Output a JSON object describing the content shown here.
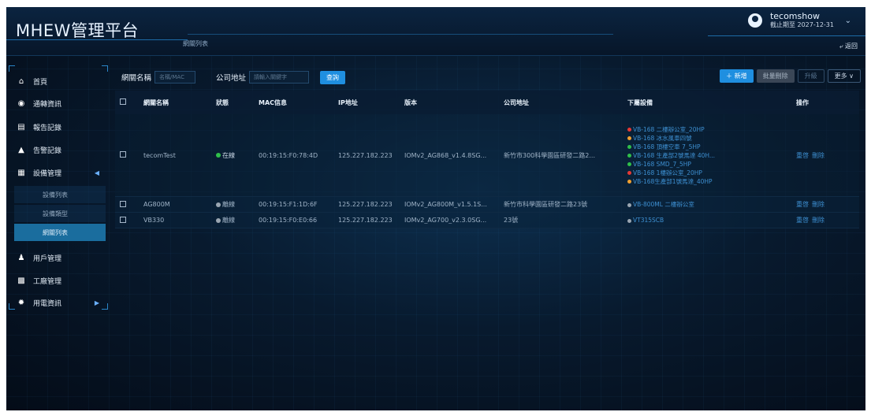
{
  "app": {
    "title": "MHEW管理平台"
  },
  "header": {
    "breadcrumb": "網關列表",
    "user_name": "tecomshow",
    "expire": "截止期至 2027-12-31",
    "back_label": "返回"
  },
  "sidebar": {
    "items": [
      {
        "label": "首頁",
        "icon": "home-icon"
      },
      {
        "label": "通轉資訊",
        "icon": "globe-icon"
      },
      {
        "label": "報告記錄",
        "icon": "report-icon"
      },
      {
        "label": "告警記錄",
        "icon": "bell-icon"
      },
      {
        "label": "設備管理",
        "icon": "grid-icon"
      },
      {
        "label": "用戶管理",
        "icon": "users-icon"
      },
      {
        "label": "工廠管理",
        "icon": "factory-icon"
      },
      {
        "label": "用電資訊",
        "icon": "gear-icon"
      }
    ],
    "sub_items": [
      {
        "label": "設備列表"
      },
      {
        "label": "設備類型"
      },
      {
        "label": "網關列表"
      }
    ]
  },
  "filters": {
    "name_label": "網關名稱",
    "name_placeholder": "名稱/MAC",
    "addr_label": "公司地址",
    "addr_placeholder": "請輸入關鍵字",
    "query_label": "查詢"
  },
  "toolbar": {
    "add_label": "＋ 新增",
    "batch_delete_label": "批量刪除",
    "upgrade_label": "升級",
    "more_label": "更多 ∨"
  },
  "table": {
    "headers": {
      "name": "網關名稱",
      "status": "狀態",
      "mac": "MAC信息",
      "ip": "IP地址",
      "version": "版本",
      "address": "公司地址",
      "devices": "下屬設備",
      "ops": "操作"
    },
    "rows": [
      {
        "name": "tecomTest",
        "status": "在線",
        "mac": "00:19:15:F0:78:4D",
        "ip": "125.227.182.223",
        "version": "IOMv2_AG868_v1.4.8SG...",
        "address": "新竹市300科學園區研發二路2...",
        "devices": [
          {
            "text": "VB-168 二樓辦公室_20HP",
            "color": "#e53935"
          },
          {
            "text": "VB-168 冰水風車四號",
            "color": "#f0a030"
          },
          {
            "text": "VB-168 頂樓空車 7_5HP",
            "color": "#2fbf4a"
          },
          {
            "text": "VB-168 生產部2號馬達 40H...",
            "color": "#2fbf4a"
          },
          {
            "text": "VB-168 SMD_7_5HP",
            "color": "#2fbf4a"
          },
          {
            "text": "VB-168 1樓辦公室_20HP",
            "color": "#e53935"
          },
          {
            "text": "VB-168生產部1號馬達_40HP",
            "color": "#f0a030"
          }
        ],
        "op_reset": "重啓",
        "op_delete": "刪除"
      },
      {
        "name": "AG800M",
        "status": "離線",
        "mac": "00:19:15:F1:1D:6F",
        "ip": "125.227.182.223",
        "version": "IOMv2_AG800M_v1.5.1S...",
        "address": "新竹市科學園區研發二路23號",
        "devices": [
          {
            "text": "VB-800ML 二樓辦公室",
            "color": "#9aa6b2"
          }
        ],
        "op_reset": "重啓",
        "op_delete": "刪除"
      },
      {
        "name": "VB330",
        "status": "離線",
        "mac": "00:19:15:F0:E0:66",
        "ip": "125.227.182.223",
        "version": "IOMv2_AG700_v2.3.0SG...",
        "address": "23號",
        "devices": [
          {
            "text": "VT315SCB",
            "color": "#9aa6b2"
          }
        ],
        "op_reset": "重啓",
        "op_delete": "刪除"
      }
    ]
  },
  "colors": {
    "accent": "#1f8fe0",
    "online": "#2fbf4a",
    "offline": "#9aa6b2",
    "alarm": "#e53935",
    "warning": "#f0a030",
    "active_menu": "#1a6d9e"
  }
}
